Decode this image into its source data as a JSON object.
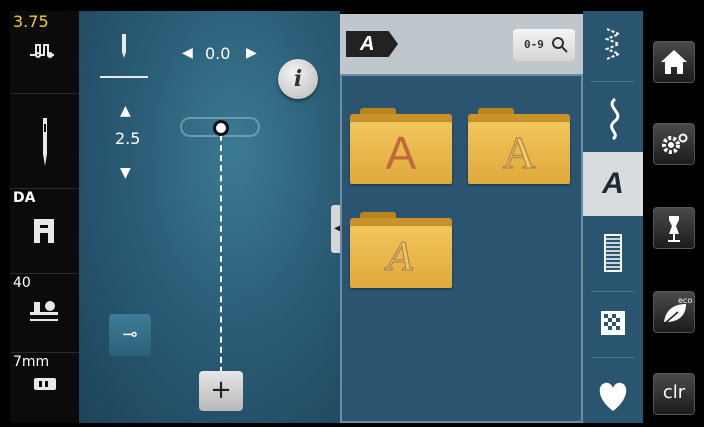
{
  "left_panel": {
    "stitch_width": "3.75",
    "presser_foot_code": "DA",
    "foot_pressure": "40",
    "stitch_plate": "7mm"
  },
  "main": {
    "needle_position": "0.0",
    "stitch_length": "2.5"
  },
  "pattern_panel": {
    "badge": "A",
    "search_label": "0-9",
    "folders": [
      {
        "letter": "A",
        "style": "sans"
      },
      {
        "letter": "A",
        "style": "outline"
      },
      {
        "letter": "A",
        "style": "script"
      }
    ]
  },
  "category_tabs": [
    {
      "icon": "zigzag-stitch-icon",
      "active": false
    },
    {
      "icon": "decorative-stitch-icon",
      "active": false
    },
    {
      "icon": "alphabet-icon",
      "label": "A",
      "active": true
    },
    {
      "icon": "buttonhole-icon",
      "active": false
    },
    {
      "icon": "quilt-stitch-icon",
      "active": false
    },
    {
      "icon": "heart-icon",
      "active": false
    }
  ],
  "right_panel": {
    "clr_label": "clr",
    "eco_label": "eco"
  },
  "colors": {
    "accent_yellow": "#f2d020",
    "folder": "#e6b14a",
    "background": "#2b5d77"
  }
}
